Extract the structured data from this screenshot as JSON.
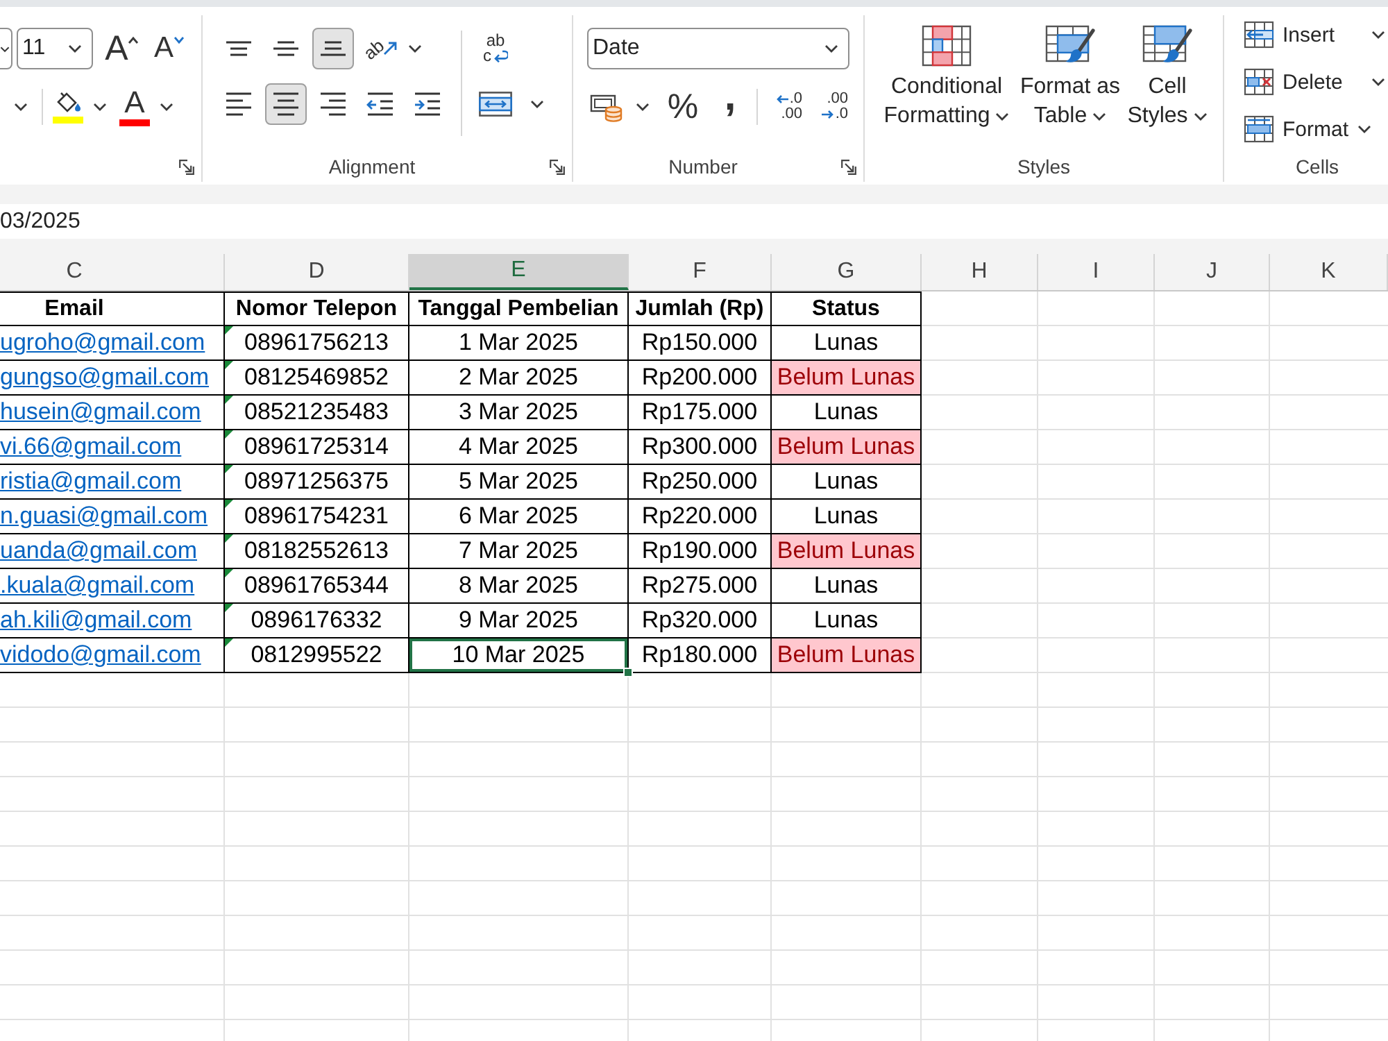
{
  "ribbon": {
    "font_group": {
      "font_size": "11",
      "size_buttons": [
        {
          "kind": "grow",
          "glyph": "A"
        },
        {
          "kind": "shrink",
          "glyph": "A"
        }
      ],
      "color_buttons": [
        {
          "kind": "fill",
          "color": "#ffff00"
        },
        {
          "kind": "font",
          "glyph": "A",
          "color": "#ff0000"
        }
      ]
    },
    "alignment_group": {
      "label": "Alignment",
      "vertical": [
        {
          "kind": "top",
          "selected": false
        },
        {
          "kind": "middle",
          "selected": false
        },
        {
          "kind": "bottom",
          "selected": true
        }
      ],
      "orientation": "ab",
      "horizontal": [
        {
          "kind": "left",
          "selected": false
        },
        {
          "kind": "center",
          "selected": true
        },
        {
          "kind": "right",
          "selected": false
        }
      ],
      "indent_buttons": [
        {
          "kind": "decrease"
        },
        {
          "kind": "increase"
        }
      ],
      "wrap_text": {
        "top": "ab",
        "bottom": "c"
      }
    },
    "number_group": {
      "label": "Number",
      "format": "Date",
      "symbols": [
        {
          "kind": "percent",
          "glyph": "%"
        },
        {
          "kind": "comma",
          "glyph": ","
        }
      ],
      "decimal_buttons": [
        {
          "kind": "increase",
          "top": ".0",
          "bottom": ".00"
        },
        {
          "kind": "decrease",
          "top": ".00",
          "bottom": ".0"
        }
      ]
    },
    "styles_group": {
      "label": "Styles",
      "buttons": [
        {
          "kind": "conditional",
          "label": "Conditional Formatting"
        },
        {
          "kind": "table",
          "label": "Format as Table"
        },
        {
          "kind": "cell",
          "label": "Cell Styles"
        }
      ]
    },
    "cells_group": {
      "label": "Cells",
      "buttons": [
        {
          "kind": "insert",
          "label": "Insert"
        },
        {
          "kind": "delete",
          "label": "Delete"
        },
        {
          "kind": "format",
          "label": "Format"
        }
      ]
    }
  },
  "formula_bar": {
    "value": "03/2025"
  },
  "sheet": {
    "columns": [
      {
        "label": "C",
        "selected": false
      },
      {
        "label": "D",
        "selected": false
      },
      {
        "label": "E",
        "selected": true
      },
      {
        "label": "F",
        "selected": false
      },
      {
        "label": "G",
        "selected": false
      },
      {
        "label": "H",
        "selected": false
      },
      {
        "label": "I",
        "selected": false
      },
      {
        "label": "J",
        "selected": false
      },
      {
        "label": "K",
        "selected": false
      }
    ],
    "header": [
      "Email",
      "Nomor Telepon",
      "Tanggal Pembelian",
      "Jumlah (Rp)",
      "Status"
    ],
    "rows": [
      {
        "email": "ugroho@gmail.com",
        "phone": "08961756213",
        "phone_warning": true,
        "date": "1 Mar 2025",
        "date_selected": false,
        "amount": "Rp150.000",
        "status": "Lunas",
        "highlighted": false
      },
      {
        "email": "gungso@gmail.com",
        "phone": "08125469852",
        "phone_warning": true,
        "date": "2 Mar 2025",
        "date_selected": false,
        "amount": "Rp200.000",
        "status": "Belum Lunas",
        "highlighted": true
      },
      {
        "email": "husein@gmail.com",
        "phone": "08521235483",
        "phone_warning": true,
        "date": "3 Mar 2025",
        "date_selected": false,
        "amount": "Rp175.000",
        "status": "Lunas",
        "highlighted": false
      },
      {
        "email": "vi.66@gmail.com",
        "phone": "08961725314",
        "phone_warning": true,
        "date": "4 Mar 2025",
        "date_selected": false,
        "amount": "Rp300.000",
        "status": "Belum Lunas",
        "highlighted": true
      },
      {
        "email": "ristia@gmail.com",
        "phone": "08971256375",
        "phone_warning": true,
        "date": "5 Mar 2025",
        "date_selected": false,
        "amount": "Rp250.000",
        "status": "Lunas",
        "highlighted": false
      },
      {
        "email": "n.guasi@gmail.com",
        "phone": "08961754231",
        "phone_warning": true,
        "date": "6 Mar 2025",
        "date_selected": false,
        "amount": "Rp220.000",
        "status": "Lunas",
        "highlighted": false
      },
      {
        "email": "uanda@gmail.com",
        "phone": "08182552613",
        "phone_warning": true,
        "date": "7 Mar 2025",
        "date_selected": false,
        "amount": "Rp190.000",
        "status": "Belum Lunas",
        "highlighted": true
      },
      {
        "email": ".kuala@gmail.com",
        "phone": "08961765344",
        "phone_warning": true,
        "date": "8 Mar 2025",
        "date_selected": false,
        "amount": "Rp275.000",
        "status": "Lunas",
        "highlighted": false
      },
      {
        "email": "ah.kili@gmail.com",
        "phone": "0896176332",
        "phone_warning": true,
        "date": "9 Mar 2025",
        "date_selected": false,
        "amount": "Rp320.000",
        "status": "Lunas",
        "highlighted": false
      },
      {
        "email": "vidodo@gmail.com",
        "phone": "0812995522",
        "phone_warning": true,
        "date": "10 Mar 2025",
        "date_selected": true,
        "amount": "Rp180.000",
        "status": "Belum Lunas",
        "highlighted": true
      }
    ]
  }
}
